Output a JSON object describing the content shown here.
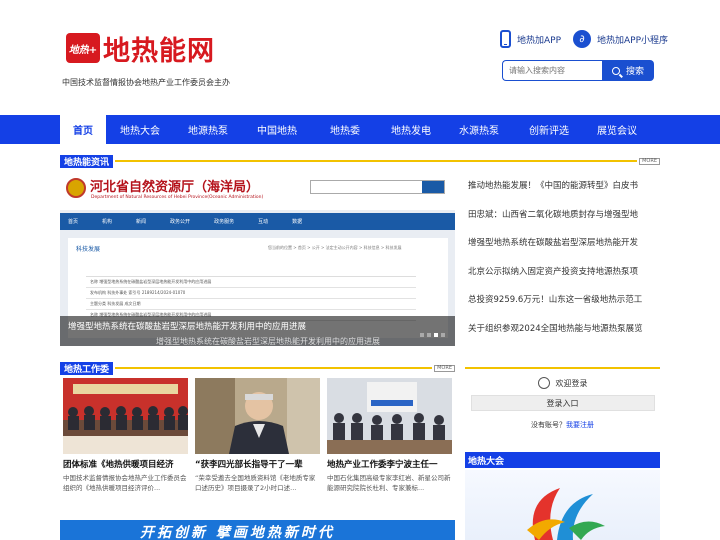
{
  "header": {
    "logo_badge": "地热+",
    "logo_text": "地热能网",
    "slogan": "中国技术监督情报协会地热产业工作委员会主办",
    "app_label": "地热加APP",
    "miniapp_label": "地热加APP小程序",
    "search_placeholder": "请输入搜索内容",
    "search_button": "搜索"
  },
  "nav": {
    "items": [
      "首页",
      "地热大会",
      "地源热泵",
      "中国地热",
      "地热委",
      "地热发电",
      "水源热泵",
      "创新评选",
      "展览会议"
    ]
  },
  "news_section": {
    "title": "地热能资讯",
    "more": "MORE"
  },
  "slideshow": {
    "dept_title": "河北省自然资源厅（海洋局）",
    "dept_sub": "Department of Natural Resources of Hebei Province(Oceanic Administration)",
    "nav_items": [
      "首页",
      "机构",
      "新闻",
      "政务公开",
      "政务服务",
      "互动",
      "数据"
    ],
    "card_title": "科技发展",
    "crumb": "您当前的位置 > 首页 > 公开 > 法定主动公开内容 > 科技信息 > 科技发展",
    "table_rows": [
      "名称    增强型地热系统在碳酸盐岩型深层地热能开发利用中的应用进展",
      "发布机构    科技外事处                    索引号    2189214/2024-01070",
      "主题分类    科技发展                      成文日期",
      "名称    增强型地热系统在碳酸盐岩型深层地热能开发利用中的应用进展"
    ],
    "caption": "增强型地热系统在碳酸盐岩型深层地热能开发利用中的应用进展",
    "caption_echo": "增强型地热系统在碳酸盐岩型深层地热能开发利用中的应用进展"
  },
  "news_list": [
    "推动地热能发展！《中国的能源转型》白皮书",
    "田忠斌：山西省二氧化碳地质封存与增强型地",
    "增强型地热系统在碳酸盐岩型深层地热能开发",
    "北京公示拟纳入固定资产投资支持地源热泵项",
    "总投资9259.6万元！山东这一省级地热示范工",
    "关于组织参观2024全国地热能与地源热泵展览"
  ],
  "work_section": {
    "title": "地热工作委",
    "more": "MORE"
  },
  "cards": [
    {
      "title": "团体标准《地热供暖项目经济",
      "desc": "中国技术监督情报协会地热产业工作委员会组织的《地热供暖项目经济评价..."
    },
    {
      "title": "“获李四光部长指导干了一辈",
      "desc": "“荣幸受邀去全国地质资料馆《老地质专家口述历史》项目摄录了2小时口述..."
    },
    {
      "title": "地热产业工作委李宁波主任一",
      "desc": "中国石化集团高级专家李红岩、新星公司新能源研究院院长杜利、专家兼标..."
    }
  ],
  "banner": {
    "text": "开拓创新 擘画地热新时代"
  },
  "login": {
    "welcome": "欢迎登录",
    "button": "登录入口",
    "no_account": "没有账号？",
    "register": "我要注册"
  },
  "expo": {
    "title": "地热大会"
  },
  "colors": {
    "brand_blue": "#1440e6",
    "brand_red": "#d7191f",
    "accent_yellow": "#f2c200"
  }
}
